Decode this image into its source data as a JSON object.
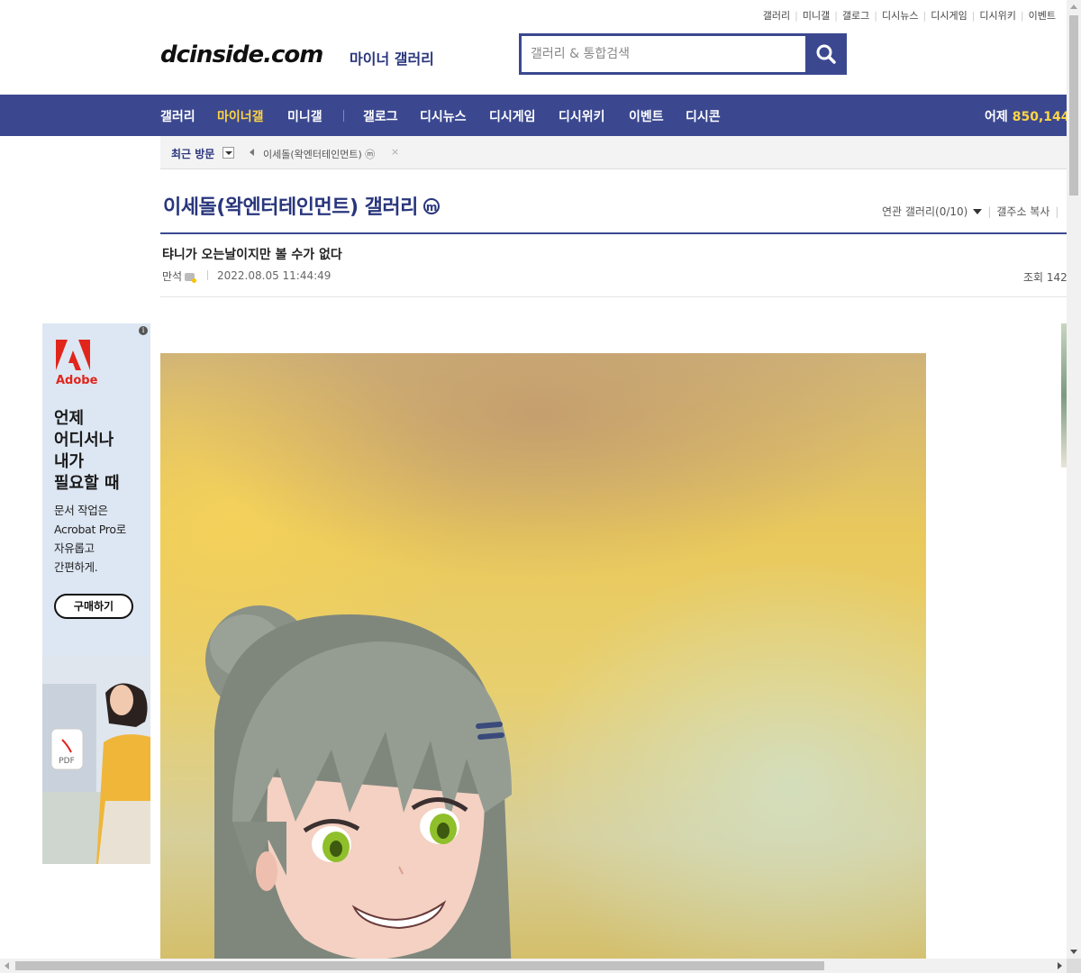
{
  "top_links": [
    "갤러리",
    "미니갤",
    "갤로그",
    "디시뉴스",
    "디시게임",
    "디시위키",
    "이벤트"
  ],
  "logo": {
    "text": "dcinside.com",
    "subtitle": "마이너 갤러리"
  },
  "search": {
    "placeholder": "갤러리 & 통합검색",
    "icon": "search-icon"
  },
  "nav": {
    "items": [
      {
        "label": "갤러리",
        "active": false
      },
      {
        "label": "마이너갤",
        "active": true
      },
      {
        "label": "미니갤",
        "active": false
      },
      {
        "label": "갤로그",
        "active": false
      },
      {
        "label": "디시뉴스",
        "active": false
      },
      {
        "label": "디시게임",
        "active": false
      },
      {
        "label": "디시위키",
        "active": false
      },
      {
        "label": "이벤트",
        "active": false
      },
      {
        "label": "디시콘",
        "active": false
      }
    ],
    "yesterday_label": "어제",
    "yesterday_count": "850,144"
  },
  "recent": {
    "label": "최근 방문",
    "gallery": "이세돌(왁엔터테인먼트) ⓜ",
    "close": "×"
  },
  "gallery": {
    "title": "이세돌(왁엔터테인먼트) 갤러리",
    "badge": "m",
    "related_label": "연관 갤러리(0/10)",
    "copy_address": "갤주소 복사",
    "more": "|"
  },
  "post": {
    "title": "탸니가 오는날이지만 볼 수가 없다",
    "author": "만석",
    "date": "2022.08.05 11:44:49",
    "views_label": "조회 142"
  },
  "ad": {
    "brand": "Adobe",
    "headline": "언제\n어디서나\n내가\n필요할 때",
    "body": "문서 작업은\nAcrobat Pro로\n자유롭고\n간편하게.",
    "cta": "구매하기",
    "file_label": "PDF"
  },
  "colors": {
    "nav_bg": "#3b4890",
    "accent": "#ffd543",
    "title": "#29367c",
    "adobe_red": "#e1251b"
  }
}
